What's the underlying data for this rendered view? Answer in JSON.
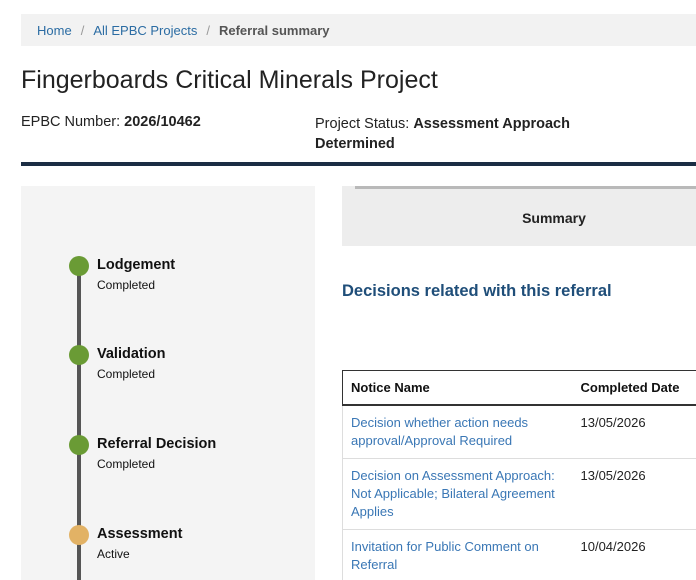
{
  "breadcrumb": {
    "home": "Home",
    "projects": "All EPBC Projects",
    "current": "Referral summary",
    "separator": "/"
  },
  "page": {
    "title": "Fingerboards Critical Minerals Project",
    "epbc_label": "EPBC Number: ",
    "epbc_value": "2026/10462",
    "status_label": "Project Status: ",
    "status_value": "Assessment Approach Determined"
  },
  "timeline": {
    "steps": [
      {
        "name": "Lodgement",
        "state": "Completed"
      },
      {
        "name": "Validation",
        "state": "Completed"
      },
      {
        "name": "Referral Decision",
        "state": "Completed"
      },
      {
        "name": "Assessment",
        "state": "Active"
      }
    ]
  },
  "tabs": {
    "summary": "Summary"
  },
  "decisions": {
    "heading": "Decisions related with this referral",
    "columns": [
      "Notice Name",
      "Completed Date"
    ],
    "rows": [
      {
        "notice": "Decision whether action needs approval/Approval Required",
        "date": "13/05/2026"
      },
      {
        "notice": "Decision on Assessment Approach: Not Applicable; Bilateral Agreement Applies",
        "date": "13/05/2026"
      },
      {
        "notice": "Invitation for Public Comment on Referral",
        "date": "10/04/2026"
      }
    ]
  },
  "colors": {
    "completed": "#6a9b35",
    "active": "#e2b265",
    "heading": "#1f4e79",
    "link": "#3a77b5"
  }
}
